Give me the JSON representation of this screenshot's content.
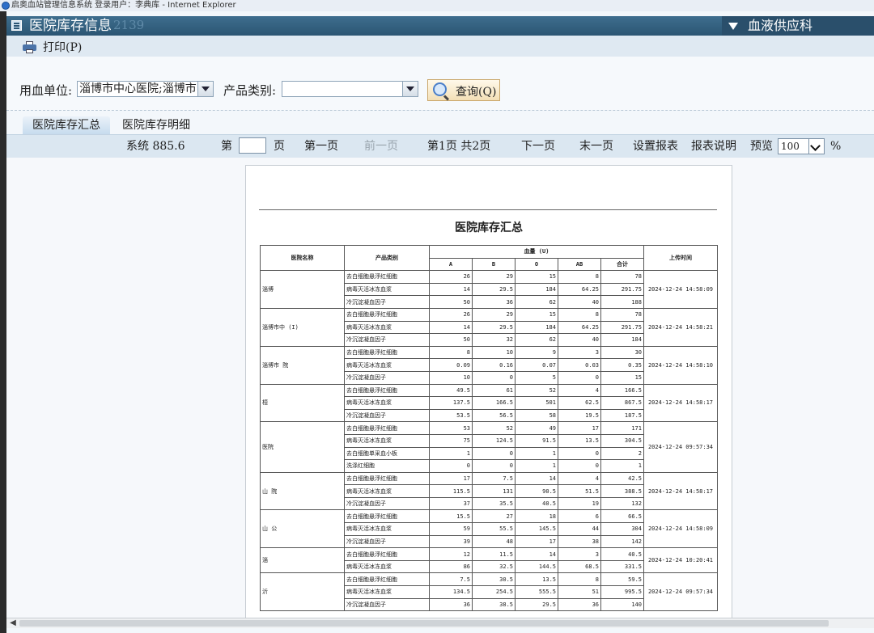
{
  "window": {
    "title": "启奥血站管理信息系统 登录用户：李典库 - Internet Explorer"
  },
  "header": {
    "title": "医院库存信息",
    "count": "2139",
    "dept": "血液供应科"
  },
  "toolbar": {
    "print": "打印(P)"
  },
  "filter": {
    "unit_label": "用血单位:",
    "unit_value": "淄博市中心医院;淄博市",
    "category_label": "产品类别:",
    "category_value": "",
    "query": "查询(Q)"
  },
  "tabs": [
    {
      "label": "医院库存汇总",
      "active": true
    },
    {
      "label": "医院库存明细",
      "active": false
    }
  ],
  "report_toolbar": {
    "system": "系统 885.6",
    "page_prefix": "第",
    "page_suffix": "页",
    "first": "第一页",
    "prev": "前一页",
    "page_info": "第1页 共2页",
    "next": "下一页",
    "last": "末一页",
    "settings": "设置报表",
    "help": "报表说明",
    "preview": "预览",
    "zoom": "100",
    "percent": "%"
  },
  "report": {
    "title": "医院库存汇总",
    "headers": {
      "hospital": "医院名称",
      "category": "产品类别",
      "blood": "血量 (U)",
      "upload": "上传时间",
      "a": "A",
      "b": "B",
      "o": "O",
      "ab": "AB",
      "total": "合计"
    },
    "groups": [
      {
        "hospital": "淄博",
        "time": "2024-12-24 14:58:09",
        "rows": [
          {
            "cat": "去白细胞悬浮红细胞",
            "a": "26",
            "b": "29",
            "o": "15",
            "ab": "8",
            "t": "78"
          },
          {
            "cat": "病毒灭活冰冻血浆",
            "a": "14",
            "b": "29.5",
            "o": "184",
            "ab": "64.25",
            "t": "291.75"
          },
          {
            "cat": "冷沉淀凝血因子",
            "a": "50",
            "b": "36",
            "o": "62",
            "ab": "40",
            "t": "188"
          }
        ]
      },
      {
        "hospital": "淄博市中 (I)",
        "time": "2024-12-24 14:58:21",
        "rows": [
          {
            "cat": "去白细胞悬浮红细胞",
            "a": "26",
            "b": "29",
            "o": "15",
            "ab": "8",
            "t": "78"
          },
          {
            "cat": "病毒灭活冰冻血浆",
            "a": "14",
            "b": "29.5",
            "o": "184",
            "ab": "64.25",
            "t": "291.75"
          },
          {
            "cat": "冷沉淀凝血因子",
            "a": "50",
            "b": "32",
            "o": "62",
            "ab": "40",
            "t": "184"
          }
        ]
      },
      {
        "hospital": "淄博市 院",
        "time": "2024-12-24 14:58:10",
        "rows": [
          {
            "cat": "去白细胞悬浮红细胞",
            "a": "8",
            "b": "10",
            "o": "9",
            "ab": "3",
            "t": "30"
          },
          {
            "cat": "病毒灭活冰冻血浆",
            "a": "0.09",
            "b": "0.16",
            "o": "0.07",
            "ab": "0.03",
            "t": "0.35"
          },
          {
            "cat": "冷沉淀凝血因子",
            "a": "10",
            "b": "0",
            "o": "5",
            "ab": "0",
            "t": "15"
          }
        ]
      },
      {
        "hospital": "桓",
        "time": "2024-12-24 14:58:17",
        "rows": [
          {
            "cat": "去白细胞悬浮红细胞",
            "a": "49.5",
            "b": "61",
            "o": "52",
            "ab": "4",
            "t": "166.5"
          },
          {
            "cat": "病毒灭活冰冻血浆",
            "a": "137.5",
            "b": "166.5",
            "o": "501",
            "ab": "62.5",
            "t": "867.5"
          },
          {
            "cat": "冷沉淀凝血因子",
            "a": "53.5",
            "b": "56.5",
            "o": "58",
            "ab": "19.5",
            "t": "187.5"
          }
        ]
      },
      {
        "hospital": "医院",
        "time": "2024-12-24 09:57:34",
        "rows": [
          {
            "cat": "去白细胞悬浮红细胞",
            "a": "53",
            "b": "52",
            "o": "49",
            "ab": "17",
            "t": "171"
          },
          {
            "cat": "病毒灭活冰冻血浆",
            "a": "75",
            "b": "124.5",
            "o": "91.5",
            "ab": "13.5",
            "t": "304.5"
          },
          {
            "cat": "去白细胞单采血小板",
            "a": "1",
            "b": "0",
            "o": "1",
            "ab": "0",
            "t": "2"
          },
          {
            "cat": "洗涤红细胞",
            "a": "0",
            "b": "0",
            "o": "1",
            "ab": "0",
            "t": "1"
          }
        ]
      },
      {
        "hospital": "山 院",
        "time": "2024-12-24 14:58:17",
        "rows": [
          {
            "cat": "去白细胞悬浮红细胞",
            "a": "17",
            "b": "7.5",
            "o": "14",
            "ab": "4",
            "t": "42.5"
          },
          {
            "cat": "病毒灭活冰冻血浆",
            "a": "115.5",
            "b": "131",
            "o": "90.5",
            "ab": "51.5",
            "t": "388.5"
          },
          {
            "cat": "冷沉淀凝血因子",
            "a": "37",
            "b": "35.5",
            "o": "40.5",
            "ab": "19",
            "t": "132"
          }
        ]
      },
      {
        "hospital": "山 公",
        "time": "2024-12-24 14:58:09",
        "rows": [
          {
            "cat": "去白细胞悬浮红细胞",
            "a": "15.5",
            "b": "27",
            "o": "18",
            "ab": "6",
            "t": "66.5"
          },
          {
            "cat": "病毒灭活冰冻血浆",
            "a": "59",
            "b": "55.5",
            "o": "145.5",
            "ab": "44",
            "t": "304"
          },
          {
            "cat": "冷沉淀凝血因子",
            "a": "39",
            "b": "48",
            "o": "17",
            "ab": "38",
            "t": "142"
          }
        ]
      },
      {
        "hospital": "淄",
        "time": "2024-12-24 10:20:41",
        "rows": [
          {
            "cat": "去白细胞悬浮红细胞",
            "a": "12",
            "b": "11.5",
            "o": "14",
            "ab": "3",
            "t": "40.5"
          },
          {
            "cat": "病毒灭活冰冻血浆",
            "a": "86",
            "b": "32.5",
            "o": "144.5",
            "ab": "68.5",
            "t": "331.5"
          }
        ]
      },
      {
        "hospital": "沂",
        "time": "2024-12-24 09:57:34",
        "rows": [
          {
            "cat": "去白细胞悬浮红细胞",
            "a": "7.5",
            "b": "30.5",
            "o": "13.5",
            "ab": "8",
            "t": "59.5"
          },
          {
            "cat": "病毒灭活冰冻血浆",
            "a": "134.5",
            "b": "254.5",
            "o": "555.5",
            "ab": "51",
            "t": "995.5"
          },
          {
            "cat": "冷沉淀凝血因子",
            "a": "36",
            "b": "38.5",
            "o": "29.5",
            "ab": "36",
            "t": "140"
          }
        ]
      }
    ]
  }
}
